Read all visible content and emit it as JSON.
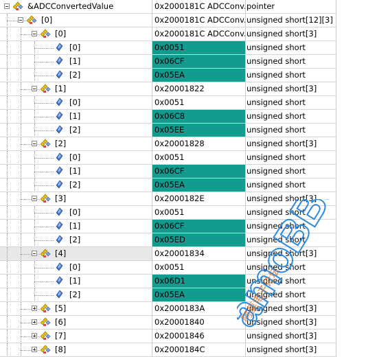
{
  "colors": {
    "highlight": "#139b8f",
    "watermark": "#2a8ae0"
  },
  "rows": [
    {
      "level": 0,
      "exp": "minus",
      "icon": "struct-icon",
      "label": "&ADCConvertedValue",
      "value": "0x2000181C ADCConv...",
      "type": "pointer",
      "hl": false
    },
    {
      "level": 1,
      "exp": "minus",
      "icon": "struct-icon",
      "label": "[0]",
      "value": "0x2000181C ADCConv...",
      "type": "unsigned short[12][3]",
      "hl": false
    },
    {
      "level": 2,
      "exp": "minus",
      "icon": "struct-icon",
      "label": "[0]",
      "value": "0x2000181C ADCConv...",
      "type": "unsigned short[3]",
      "hl": false
    },
    {
      "level": 3,
      "exp": null,
      "icon": "variable-icon",
      "label": "[0]",
      "value": "0x0051",
      "type": "unsigned short",
      "hl": true
    },
    {
      "level": 3,
      "exp": null,
      "icon": "variable-icon",
      "label": "[1]",
      "value": "0x06CF",
      "type": "unsigned short",
      "hl": true
    },
    {
      "level": 3,
      "exp": null,
      "icon": "variable-icon",
      "label": "[2]",
      "value": "0x05EA",
      "type": "unsigned short",
      "hl": true
    },
    {
      "level": 2,
      "exp": "minus",
      "icon": "struct-icon",
      "label": "[1]",
      "value": "0x20001822",
      "type": "unsigned short[3]",
      "hl": false
    },
    {
      "level": 3,
      "exp": null,
      "icon": "variable-icon",
      "label": "[0]",
      "value": "0x0051",
      "type": "unsigned short",
      "hl": false
    },
    {
      "level": 3,
      "exp": null,
      "icon": "variable-icon",
      "label": "[1]",
      "value": "0x06C8",
      "type": "unsigned short",
      "hl": true
    },
    {
      "level": 3,
      "exp": null,
      "icon": "variable-icon",
      "label": "[2]",
      "value": "0x05EE",
      "type": "unsigned short",
      "hl": true
    },
    {
      "level": 2,
      "exp": "minus",
      "icon": "struct-icon",
      "label": "[2]",
      "value": "0x20001828",
      "type": "unsigned short[3]",
      "hl": false
    },
    {
      "level": 3,
      "exp": null,
      "icon": "variable-icon",
      "label": "[0]",
      "value": "0x0051",
      "type": "unsigned short",
      "hl": false
    },
    {
      "level": 3,
      "exp": null,
      "icon": "variable-icon",
      "label": "[1]",
      "value": "0x06CF",
      "type": "unsigned short",
      "hl": true
    },
    {
      "level": 3,
      "exp": null,
      "icon": "variable-icon",
      "label": "[2]",
      "value": "0x05EA",
      "type": "unsigned short",
      "hl": true
    },
    {
      "level": 2,
      "exp": "minus",
      "icon": "struct-icon",
      "label": "[3]",
      "value": "0x2000182E",
      "type": "unsigned short[3]",
      "hl": false
    },
    {
      "level": 3,
      "exp": null,
      "icon": "variable-icon",
      "label": "[0]",
      "value": "0x0051",
      "type": "unsigned short",
      "hl": false
    },
    {
      "level": 3,
      "exp": null,
      "icon": "variable-icon",
      "label": "[1]",
      "value": "0x06CF",
      "type": "unsigned short",
      "hl": true
    },
    {
      "level": 3,
      "exp": null,
      "icon": "variable-icon",
      "label": "[2]",
      "value": "0x05ED",
      "type": "unsigned short",
      "hl": true
    },
    {
      "level": 2,
      "exp": "minus",
      "icon": "struct-icon",
      "label": "[4]",
      "value": "0x20001834",
      "type": "unsigned short[3]",
      "hl": false,
      "sel": true
    },
    {
      "level": 3,
      "exp": null,
      "icon": "variable-icon",
      "label": "[0]",
      "value": "0x0051",
      "type": "unsigned short",
      "hl": false
    },
    {
      "level": 3,
      "exp": null,
      "icon": "variable-icon",
      "label": "[1]",
      "value": "0x06D1",
      "type": "unsigned short",
      "hl": true
    },
    {
      "level": 3,
      "exp": null,
      "icon": "variable-icon",
      "label": "[2]",
      "value": "0x05EA",
      "type": "unsigned short",
      "hl": true
    },
    {
      "level": 2,
      "exp": "plus",
      "icon": "struct-icon",
      "label": "[5]",
      "value": "0x2000183A",
      "type": "unsigned short[3]",
      "hl": false
    },
    {
      "level": 2,
      "exp": "plus",
      "icon": "struct-icon",
      "label": "[6]",
      "value": "0x20001840",
      "type": "unsigned short[3]",
      "hl": false
    },
    {
      "level": 2,
      "exp": "plus",
      "icon": "struct-icon",
      "label": "[7]",
      "value": "0x20001846",
      "type": "unsigned short[3]",
      "hl": false
    },
    {
      "level": 2,
      "exp": "plus",
      "icon": "struct-icon",
      "label": "[8]",
      "value": "0x2000184C",
      "type": "unsigned short[3]",
      "hl": false
    }
  ],
  "watermark": {
    "brand": "amoBBS",
    "tagline": "阿莫电子论坛"
  }
}
